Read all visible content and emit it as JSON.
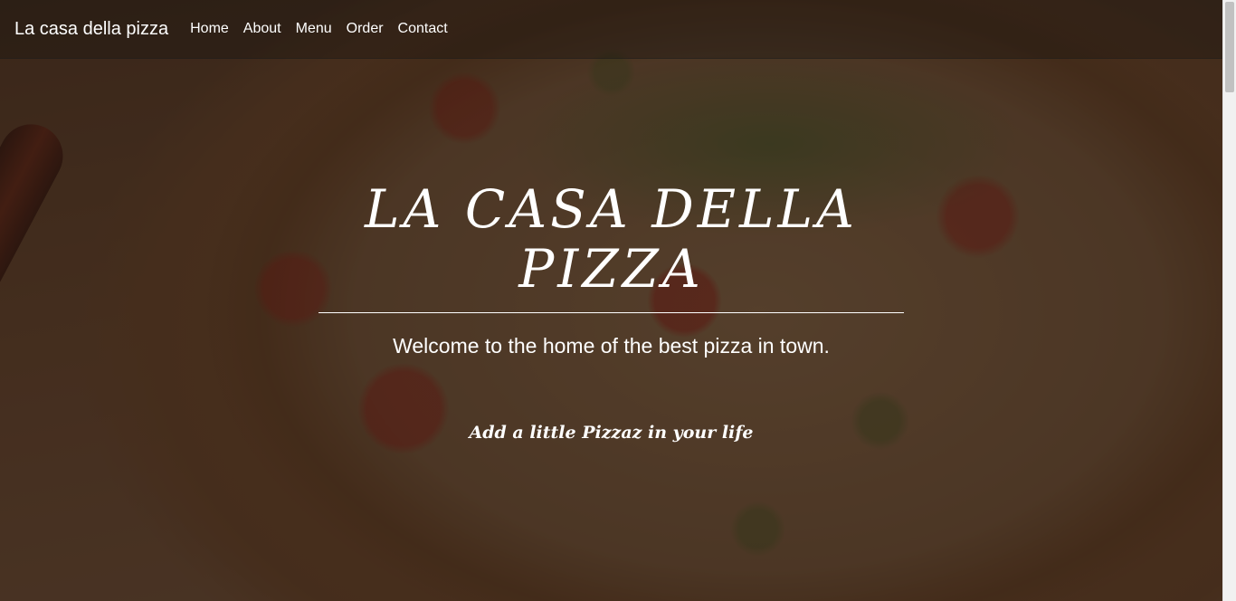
{
  "navbar": {
    "brand": "La casa della pizza",
    "links": [
      "Home",
      "About",
      "Menu",
      "Order",
      "Contact"
    ]
  },
  "hero": {
    "title": "LA CASA DELLA PIZZA",
    "subtitle": "Welcome to the home of the best pizza in town.",
    "tagline": "Add a little Pizzaz in your life"
  },
  "colors": {
    "text": "#ffffff",
    "overlay": "#140c08"
  }
}
